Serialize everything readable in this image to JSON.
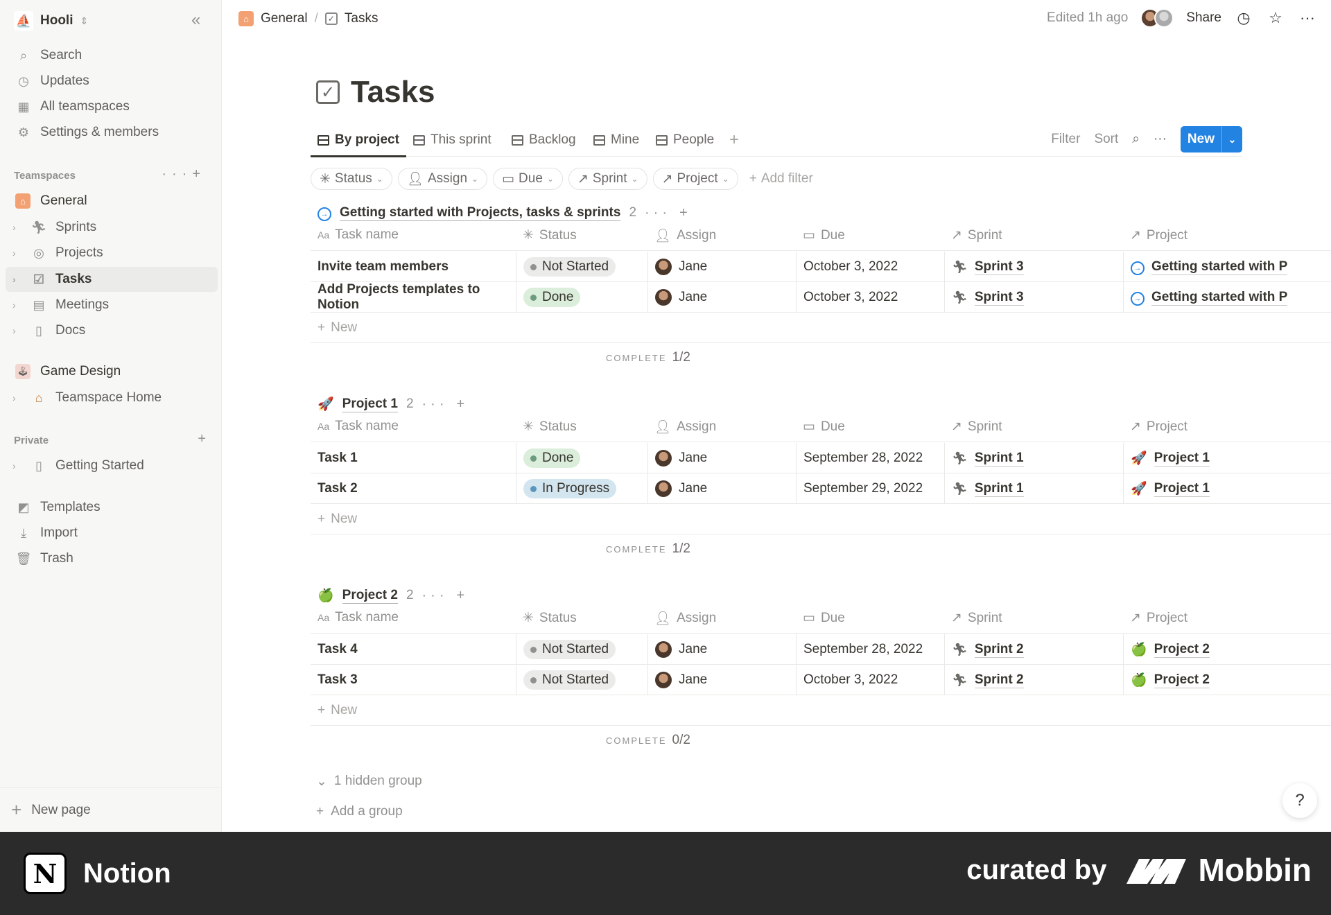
{
  "workspace": {
    "name": "Hooli"
  },
  "sidebar": {
    "top_items": [
      {
        "label": "Search",
        "icon": "search-icon"
      },
      {
        "label": "Updates",
        "icon": "clock-icon"
      },
      {
        "label": "All teamspaces",
        "icon": "building-icon"
      },
      {
        "label": "Settings & members",
        "icon": "gear-icon"
      }
    ],
    "teamspaces_label": "Teamspaces",
    "teamspace_general": "General",
    "tree_items": [
      {
        "label": "Sprints",
        "icon": "runner-icon"
      },
      {
        "label": "Projects",
        "icon": "target-icon"
      },
      {
        "label": "Tasks",
        "icon": "checkbox-icon",
        "active": true
      },
      {
        "label": "Meetings",
        "icon": "notes-icon"
      },
      {
        "label": "Docs",
        "icon": "page-icon"
      }
    ],
    "game_design": "Game Design",
    "teamspace_home": "Teamspace Home",
    "private_label": "Private",
    "getting_started": "Getting Started",
    "bottom_items": [
      {
        "label": "Templates",
        "icon": "templates-icon"
      },
      {
        "label": "Import",
        "icon": "download-icon"
      },
      {
        "label": "Trash",
        "icon": "trash-icon"
      }
    ],
    "new_page": "New page"
  },
  "topbar": {
    "breadcrumb": [
      "General",
      "/",
      "Tasks"
    ],
    "edited": "Edited 1h ago",
    "share": "Share"
  },
  "page": {
    "title": "Tasks",
    "views": [
      "By project",
      "This sprint",
      "Backlog",
      "Mine",
      "People"
    ],
    "actions": {
      "filter": "Filter",
      "sort": "Sort",
      "new": "New"
    },
    "filters": [
      "Status",
      "Assign",
      "Due",
      "Sprint",
      "Project"
    ],
    "add_filter": "Add filter",
    "columns": [
      "Task name",
      "Status",
      "Assign",
      "Due",
      "Sprint",
      "Project"
    ],
    "new_row": "New",
    "complete_label": "COMPLETE",
    "hidden_group": "1 hidden group",
    "add_group": "Add a group",
    "help": "?"
  },
  "groups": [
    {
      "name": "Getting started with Projects, tasks & sprints",
      "count": "2",
      "complete": "1/2",
      "rows": [
        {
          "task": "Invite team members",
          "status": "Not Started",
          "assign": "Jane",
          "due": "October 3, 2022",
          "sprint": "Sprint 3",
          "project": "Getting started with P"
        },
        {
          "task": "Add Projects templates to Notion",
          "status": "Done",
          "assign": "Jane",
          "due": "October 3, 2022",
          "sprint": "Sprint 3",
          "project": "Getting started with P"
        }
      ]
    },
    {
      "name": "Project 1",
      "count": "2",
      "complete": "1/2",
      "rows": [
        {
          "task": "Task 1",
          "status": "Done",
          "assign": "Jane",
          "due": "September 28, 2022",
          "sprint": "Sprint 1",
          "project": "Project 1"
        },
        {
          "task": "Task 2",
          "status": "In Progress",
          "assign": "Jane",
          "due": "September 29, 2022",
          "sprint": "Sprint 1",
          "project": "Project 1"
        }
      ]
    },
    {
      "name": "Project 2",
      "count": "2",
      "complete": "0/2",
      "rows": [
        {
          "task": "Task 4",
          "status": "Not Started",
          "assign": "Jane",
          "due": "September 28, 2022",
          "sprint": "Sprint 2",
          "project": "Project 2"
        },
        {
          "task": "Task 3",
          "status": "Not Started",
          "assign": "Jane",
          "due": "October 3, 2022",
          "sprint": "Sprint 2",
          "project": "Project 2"
        }
      ]
    }
  ],
  "footer": {
    "app": "Notion",
    "curated": "curated by",
    "brand": "Mobbin"
  }
}
